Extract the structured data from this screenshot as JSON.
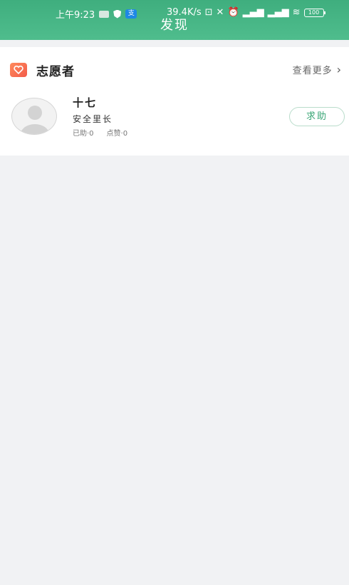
{
  "status_bar": {
    "time": "上午9:23",
    "net_speed": "39.4K/s",
    "battery": "100",
    "icons": [
      "message-icon",
      "shield-icon",
      "alipay-icon",
      "nfc-icon",
      "mute-icon",
      "alarm-icon",
      "signal-icon",
      "signal-icon",
      "wifi-icon",
      "battery-icon"
    ]
  },
  "header": {
    "title": "发现"
  },
  "volunteer_section": {
    "title": "志愿者",
    "more_label": "查看更多",
    "more_icon": "chevron-right-icon",
    "badge_icon": "heart-icon",
    "badge_color": "#f4694f",
    "volunteers": [
      {
        "name": "十七",
        "role": "安全里长",
        "helped": "已助·0",
        "likes": "点赞·0",
        "action_label": "求助",
        "avatar_icon": "default-avatar-icon"
      }
    ]
  },
  "colors": {
    "brand_green": "#43b383",
    "page_bg": "#f1f2f4",
    "button_text": "#3aa676"
  }
}
